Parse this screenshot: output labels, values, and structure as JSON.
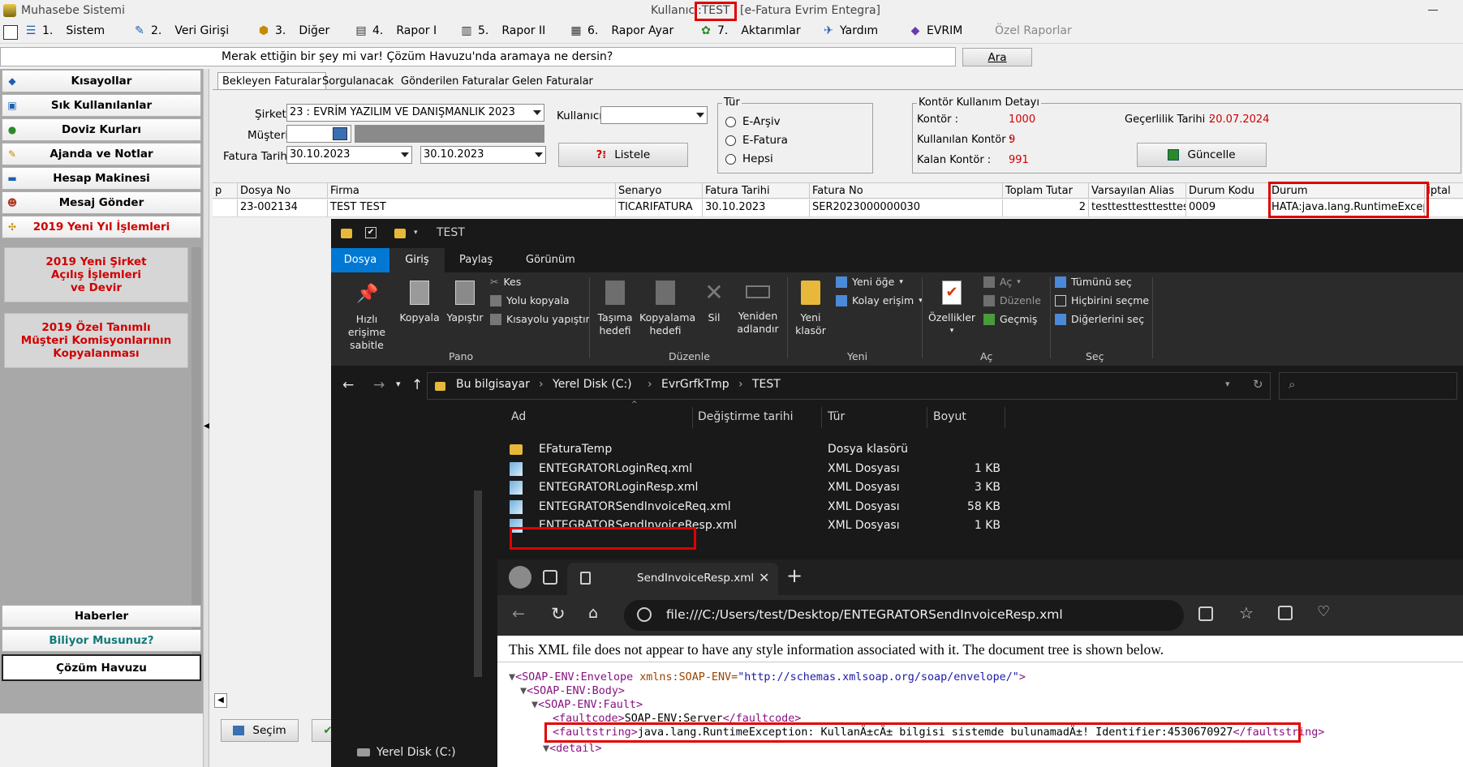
{
  "app": {
    "title": "Muhasebe Sistemi",
    "user_label": "Kullanıcı",
    "user_value": ":TEST",
    "integrator": "[e-Fatura Evrim Entegra]"
  },
  "menu": [
    {
      "num": "1.",
      "label": "Sistem",
      "icon": "system-icon"
    },
    {
      "num": "2.",
      "label": "Veri Girişi",
      "icon": "data-entry-icon"
    },
    {
      "num": "3.",
      "label": "Diğer",
      "icon": "other-icon"
    },
    {
      "num": "4.",
      "label": "Rapor I",
      "icon": "report-icon"
    },
    {
      "num": "5.",
      "label": "Rapor II",
      "icon": "report2-icon"
    },
    {
      "num": "6.",
      "label": "Rapor Ayar",
      "icon": "report-settings-icon"
    },
    {
      "num": "7.",
      "label": "Aktarımlar",
      "icon": "transfer-icon"
    },
    {
      "num": "",
      "label": "Yardım",
      "icon": "help-icon"
    },
    {
      "num": "",
      "label": "EVRIM",
      "icon": "evrim-icon"
    },
    {
      "num": "",
      "label": "Özel Raporlar",
      "icon": ""
    }
  ],
  "search": {
    "prompt": "Merak ettiğin bir şey mi var! Çözüm Havuzu'nda aramaya ne dersin?",
    "button": "Ara"
  },
  "sidebar": {
    "items": [
      "Kısayollar",
      "Sık Kullanılanlar",
      "Doviz Kurları",
      "Ajanda ve Notlar",
      "Hesap Makinesi",
      "Mesaj Gönder",
      "2019 Yeni Yıl İşlemleri"
    ],
    "big_buttons": [
      [
        "2019 Yeni Şirket",
        "Açılış İşlemleri",
        "ve Devir"
      ],
      [
        "2019 Özel Tanımlı",
        "Müşteri Komisyonlarının",
        "Kopyalanması"
      ]
    ],
    "bottom": [
      "Haberler",
      "Biliyor Musunuz?",
      "Çözüm Havuzu"
    ]
  },
  "tabs": [
    "Bekleyen Faturalar",
    "Sorgulanacak",
    "Gönderilen Faturalar",
    "Gelen Faturalar"
  ],
  "filters": {
    "sirket_label": "Şirket",
    "sirket_value": "23 : EVRİM YAZILIM  VE DANIŞMANLIK 2023",
    "musteri_label": "Müşteri",
    "fatura_tarihi_label": "Fatura Tarihi",
    "date_from": "30.10.2023",
    "date_to": "30.10.2023",
    "kullanici_label": "Kullanıcı",
    "kullanici_value": "",
    "listele": "Listele"
  },
  "tur": {
    "title": "Tür",
    "options": [
      "E-Arşiv",
      "E-Fatura",
      "Hepsi"
    ]
  },
  "kontor": {
    "title": "Kontör Kullanım Detayı",
    "kontor_label": "Kontör :",
    "kontor_value": "1000",
    "kullanilan_label": "Kullanılan Kontör :",
    "kullanilan_value": "9",
    "kalan_label": "Kalan Kontör :",
    "kalan_value": "991",
    "gecerlilik_label": "Geçerlilik Tarihi :",
    "gecerlilik_value": "20.07.2024",
    "guncelle": "Güncelle"
  },
  "grid": {
    "columns": [
      "p",
      "Dosya No",
      "Firma",
      "Senaryo",
      "Fatura Tarihi",
      "Fatura No",
      "Toplam Tutar",
      "Varsayılan Alias",
      "Durum Kodu",
      "Durum",
      "İptal"
    ],
    "row": [
      "",
      "23-002134",
      "TEST TEST",
      "TICARIFATURA",
      "30.10.2023",
      "SER2023000000030",
      "2",
      "testtesttesttesttest",
      "0009",
      "HATA:java.lang.RuntimeExcept",
      ""
    ]
  },
  "bottom_buttons": {
    "secim": "Seçim"
  },
  "explorer": {
    "title": "TEST",
    "ribbon_tabs": [
      "Dosya",
      "Giriş",
      "Paylaş",
      "Görünüm"
    ],
    "pano": {
      "group": "Pano",
      "pin": [
        "Hızlı erişime",
        "sabitle"
      ],
      "kopyala": "Kopyala",
      "yapistir": "Yapıştır",
      "kes": "Kes",
      "yolu_kopyala": "Yolu kopyala",
      "kisayolu_yapistir": "Kısayolu yapıştır"
    },
    "duzenle": {
      "group": "Düzenle",
      "tasima": [
        "Taşıma",
        "hedefi"
      ],
      "kopyalama": [
        "Kopyalama",
        "hedefi"
      ],
      "sil": "Sil",
      "yeniden": [
        "Yeniden",
        "adlandır"
      ]
    },
    "yeni": {
      "group": "Yeni",
      "klasor": [
        "Yeni",
        "klasör"
      ],
      "yeni_oge": "Yeni öğe",
      "kolay_erisim": "Kolay erişim"
    },
    "ac": {
      "group": "Aç",
      "ozellikler": "Özellikler",
      "ac": "Aç",
      "duzenle": "Düzenle",
      "gecmis": "Geçmiş"
    },
    "sec": {
      "group": "Seç",
      "tumunu": "Tümünü seç",
      "hicbirini": "Hiçbirini seçme",
      "digerlerini": "Diğerlerini seç"
    },
    "breadcrumb": [
      "Bu bilgisayar",
      "Yerel Disk (C:)",
      "EvrGrfkTmp",
      "TEST"
    ],
    "columns": [
      "Ad",
      "Değiştirme tarihi",
      "Tür",
      "Boyut"
    ],
    "files": [
      {
        "name": "EFaturaTemp",
        "type": "Dosya klasörü",
        "size": ""
      },
      {
        "name": "ENTEGRATORLoginReq.xml",
        "type": "XML Dosyası",
        "size": "1 KB"
      },
      {
        "name": "ENTEGRATORLoginResp.xml",
        "type": "XML Dosyası",
        "size": "3 KB"
      },
      {
        "name": "ENTEGRATORSendInvoiceReq.xml",
        "type": "XML Dosyası",
        "size": "58 KB"
      },
      {
        "name": "ENTEGRATORSendInvoiceResp.xml",
        "type": "XML Dosyası",
        "size": "1 KB"
      }
    ],
    "nav_pane_item": "Yerel Disk (C:)"
  },
  "browser": {
    "tab_title": "SendInvoiceResp.xml",
    "url": "file:///C:/Users/test/Desktop/ENTEGRATORSendInvoiceResp.xml",
    "notice": "This XML file does not appear to have any style information associated with it. The document tree is shown below.",
    "xml": {
      "envelope_open": "<SOAP-ENV:Envelope",
      "envelope_attr": " xmlns:SOAP-ENV=",
      "envelope_val": "\"http://schemas.xmlsoap.org/soap/envelope/\"",
      "envelope_close": ">",
      "body_open": "<SOAP-ENV:Body>",
      "fault_open": "<SOAP-ENV:Fault>",
      "faultcode_open": "<faultcode>",
      "faultcode_val": "SOAP-ENV:Server",
      "faultcode_close": "</faultcode>",
      "faultstring_open": "<faultstring>",
      "faultstring_val": "java.lang.RuntimeException: KullanÄ±cÄ± bilgisi sistemde bulunamadÄ±! Identifier:4530670927",
      "faultstring_close": "</faultstring>",
      "detail_open": "<detail>"
    }
  },
  "colors": {
    "highlight": "#e00000",
    "accent_red": "#d00000",
    "explorer_bg": "#191919",
    "ribbon_blue": "#0078d4"
  }
}
